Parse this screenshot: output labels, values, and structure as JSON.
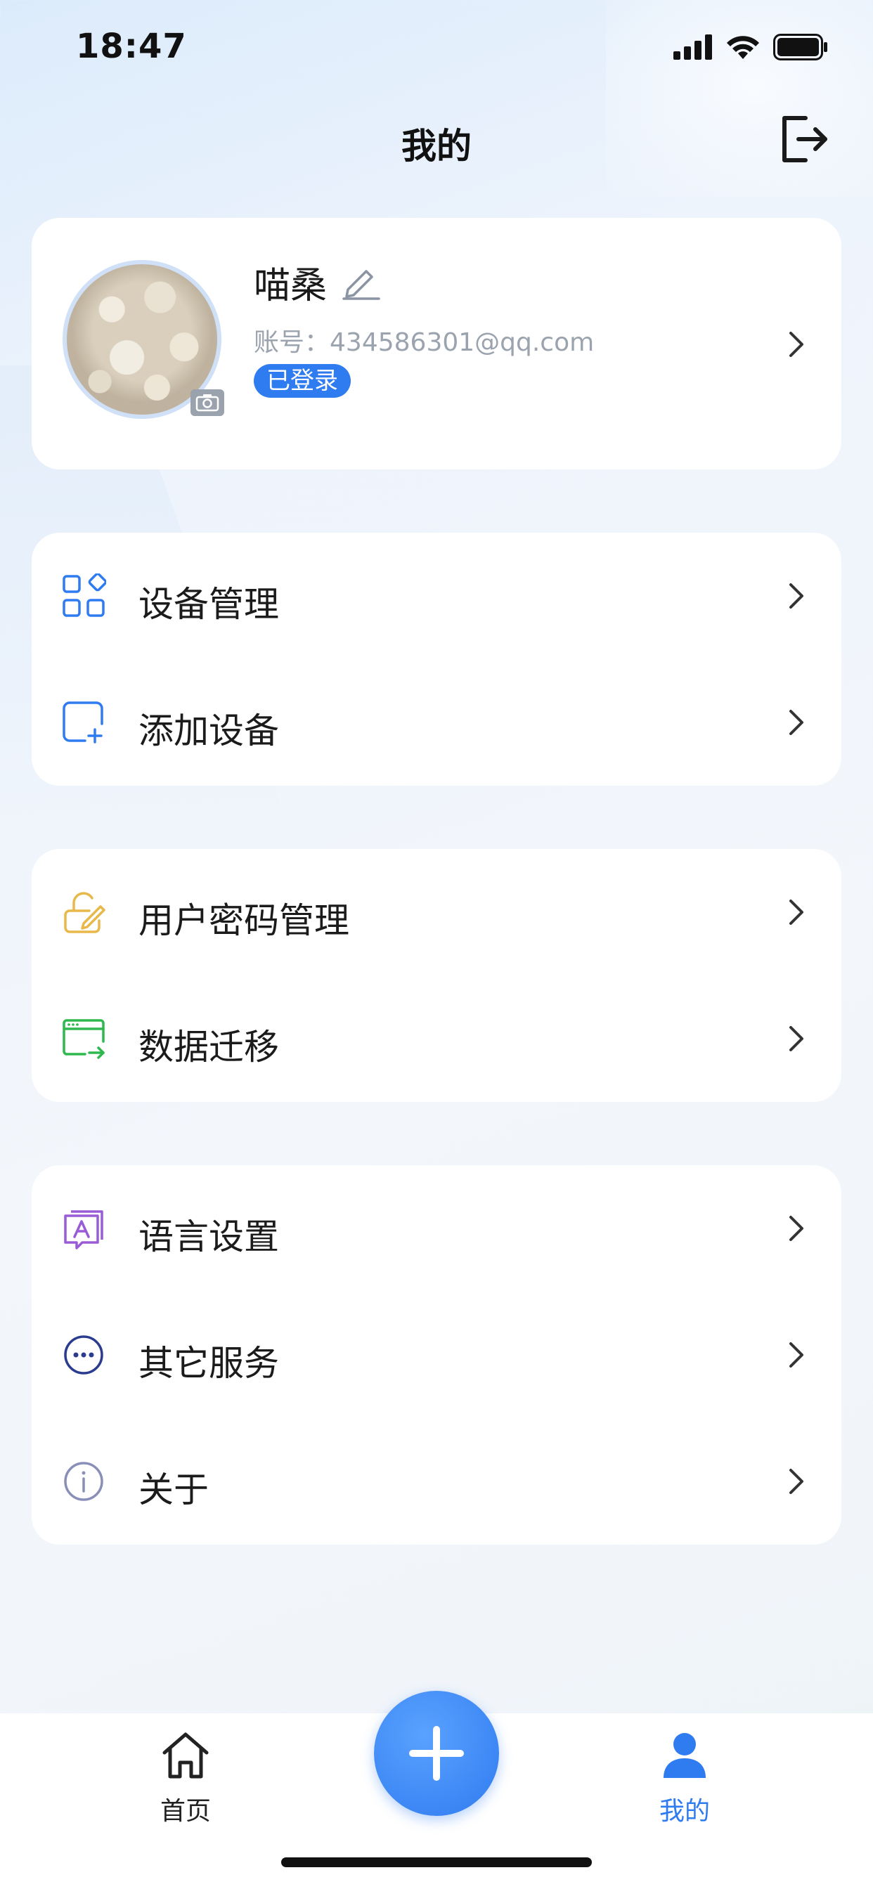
{
  "status_bar": {
    "time": "18:47"
  },
  "header": {
    "title": "我的"
  },
  "profile": {
    "nickname": "喵桑",
    "account_label": "账号：",
    "account_value": "434586301@qq.com",
    "login_status": "已登录"
  },
  "menu_groups": [
    {
      "items": [
        {
          "label": "设备管理",
          "icon": "grid-apps-icon",
          "color": "#2f7bf0"
        },
        {
          "label": "添加设备",
          "icon": "add-device-icon",
          "color": "#2f7bf0"
        }
      ]
    },
    {
      "items": [
        {
          "label": "用户密码管理",
          "icon": "lock-edit-icon",
          "color": "#e8b94a"
        },
        {
          "label": "数据迁移",
          "icon": "data-migrate-icon",
          "color": "#2fb84e"
        }
      ]
    },
    {
      "items": [
        {
          "label": "语言设置",
          "icon": "language-icon",
          "color": "#9a5bd6"
        },
        {
          "label": "其它服务",
          "icon": "more-services-icon",
          "color": "#2b3c8f"
        },
        {
          "label": "关于",
          "icon": "info-icon",
          "color": "#8a8fb8"
        }
      ]
    }
  ],
  "tab_bar": {
    "home_label": "首页",
    "mine_label": "我的",
    "active": "mine",
    "active_color": "#2f7bf0"
  }
}
